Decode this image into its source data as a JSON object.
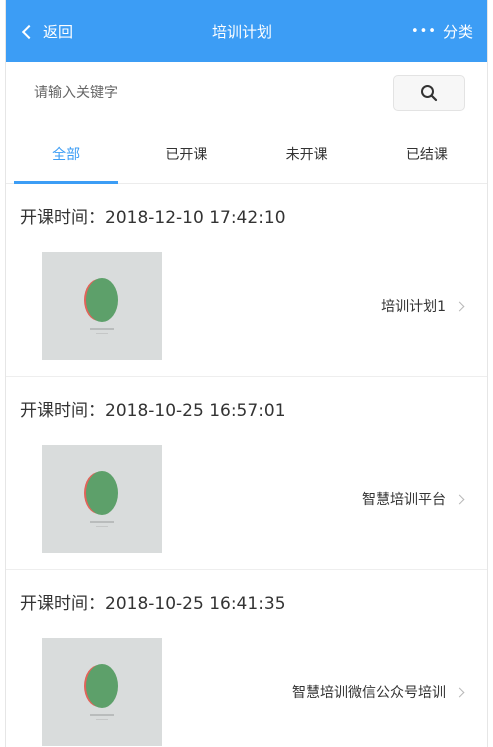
{
  "header": {
    "back_label": "返回",
    "title": "培训计划",
    "more_icon": "…",
    "category_label": "分类"
  },
  "search": {
    "placeholder": "请输入关键字",
    "value": ""
  },
  "tabs": [
    {
      "label": "全部",
      "active": true
    },
    {
      "label": "已开课",
      "active": false
    },
    {
      "label": "未开课",
      "active": false
    },
    {
      "label": "已结课",
      "active": false
    }
  ],
  "records": [
    {
      "time": "开课时间：2018-12-10 17:42:10",
      "title": "培训计划1"
    },
    {
      "time": "开课时间：2018-10-25 16:57:01",
      "title": "智慧培训平台"
    },
    {
      "time": "开课时间：2018-10-25 16:41:35",
      "title": "智慧培训微信公众号培训"
    }
  ],
  "colors": {
    "accent": "#3c9df5",
    "thumb_bg": "#d9dcdc"
  }
}
